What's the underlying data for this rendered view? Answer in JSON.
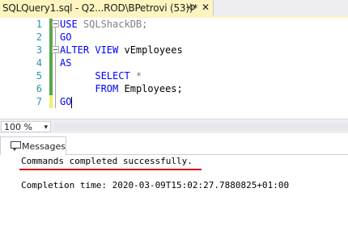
{
  "tab": {
    "title": "SQLQuery1.sql - Q2...ROD\\BPetrovi (53))*",
    "pin_icon": "pin-icon",
    "close_icon": "close-icon"
  },
  "editor": {
    "line_numbers": [
      "1",
      "2",
      "3",
      "4",
      "5",
      "6",
      "7"
    ],
    "lines": [
      {
        "kw": "USE",
        "rest": " SQLShackDB;"
      },
      {
        "kw": "GO",
        "rest": ""
      },
      {
        "kw": "ALTER VIEW",
        "rest": " vEmployees"
      },
      {
        "kw": "AS",
        "rest": ""
      },
      {
        "indent": "      ",
        "kw": "SELECT",
        "rest": " *"
      },
      {
        "indent": "      ",
        "kw": "FROM",
        "rest": " Employees;"
      },
      {
        "kw": "GO",
        "rest": ""
      }
    ],
    "colors": {
      "keyword": "#0000ff",
      "line_number": "#2b91af",
      "change_saved": "#57a64a",
      "change_unsaved": "#efef6f"
    }
  },
  "zoom": {
    "value": "100 %",
    "arrow": "▾"
  },
  "results": {
    "tab_label": "Messages",
    "tab_icon": "message-icon",
    "message": "Commands completed successfully.",
    "completion": "Completion time: 2020-03-09T15:02:27.7880825+01:00",
    "highlight_color": "#d40000"
  }
}
